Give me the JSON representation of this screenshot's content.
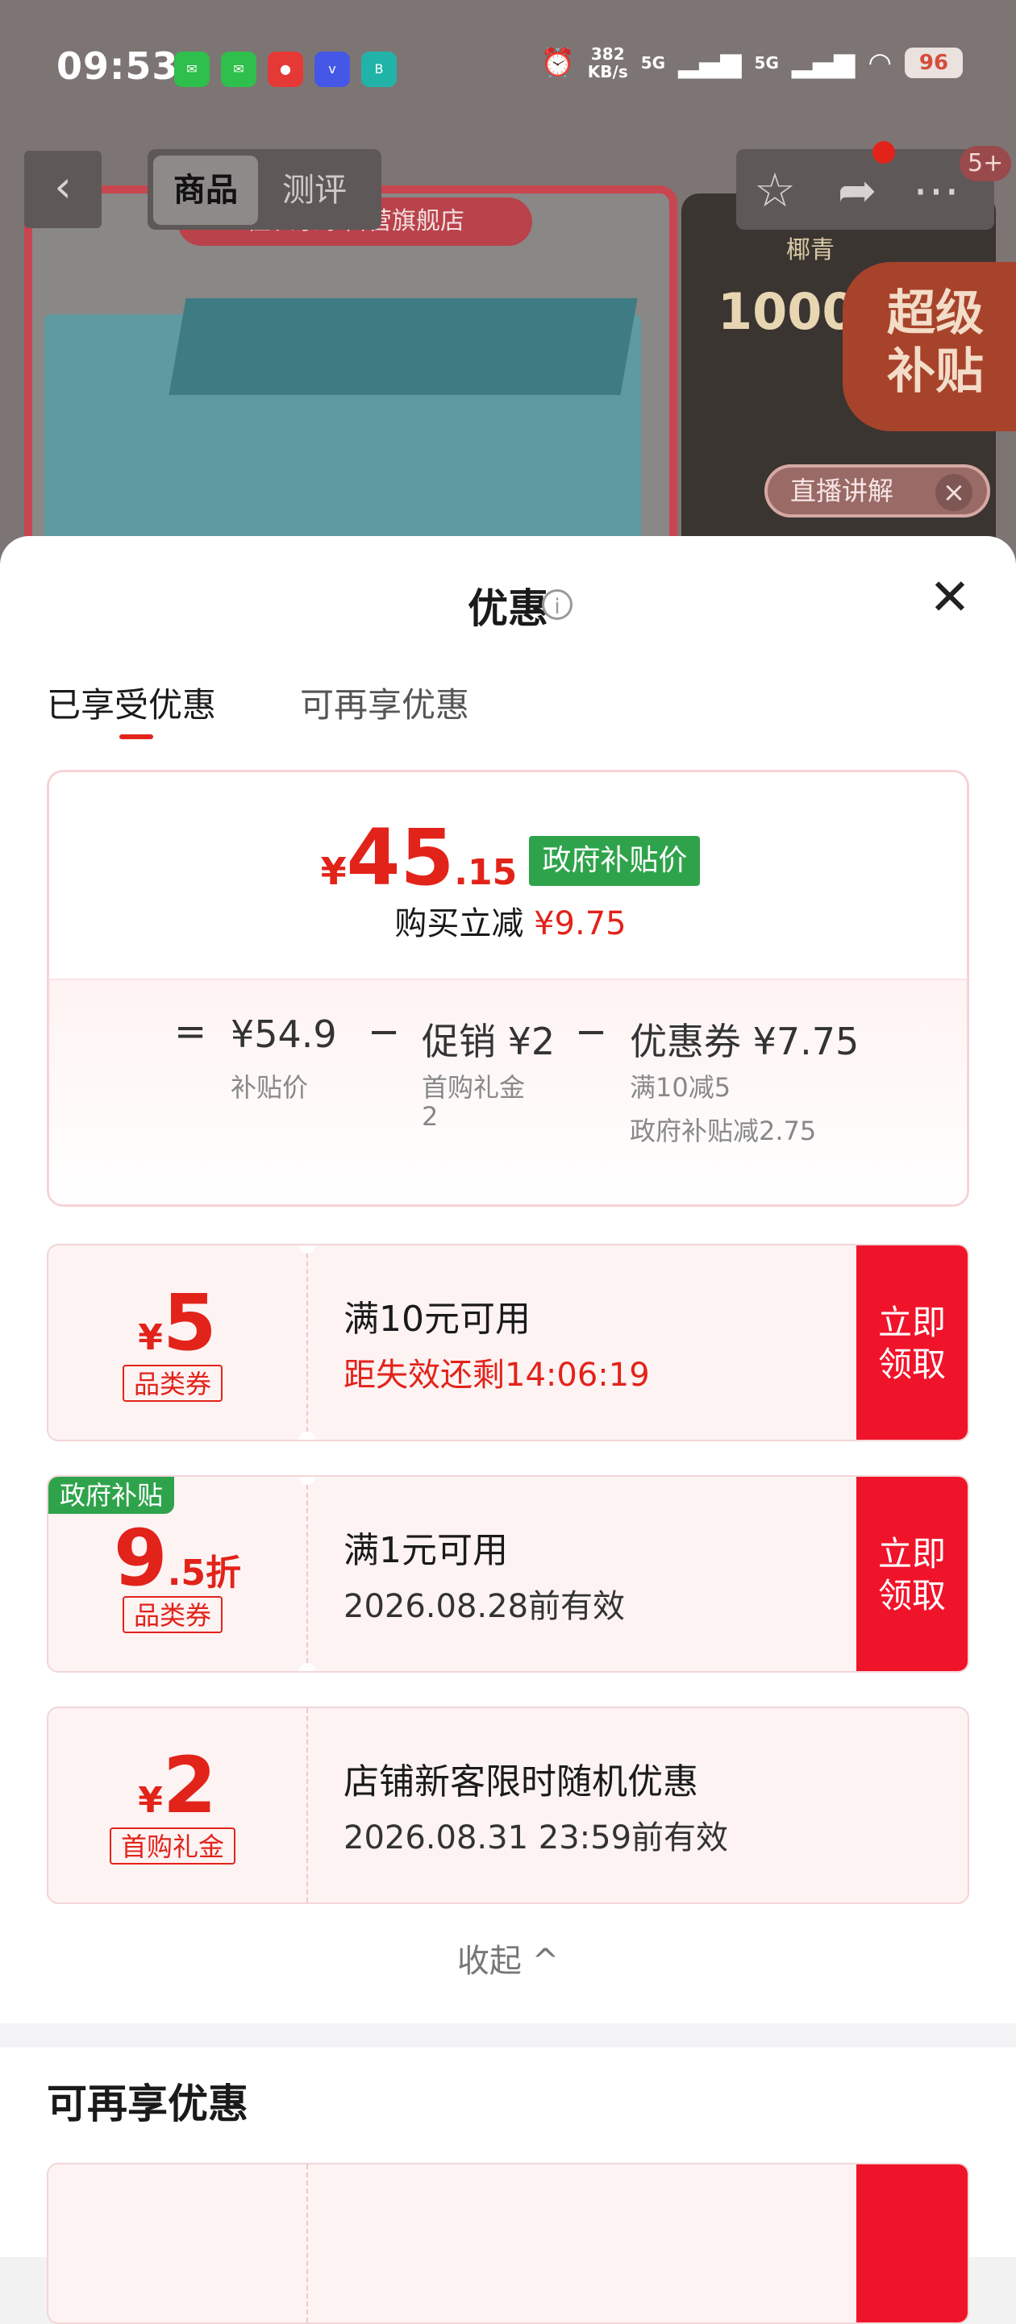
{
  "status_bar": {
    "time": "09:53",
    "speed_value": "382",
    "speed_unit": "KB/s",
    "net1": "5G",
    "net2": "5G",
    "battery": "96"
  },
  "nav": {
    "back_icon": "‹",
    "tab_product": "商品",
    "tab_review": "测评",
    "cart_count": "5+"
  },
  "background": {
    "store_name": "佳农京东自营旗舰店",
    "rank_label": "椰青",
    "rank_value": "1000",
    "subsidy_badge_line1": "超级",
    "subsidy_badge_line2": "补贴",
    "live_label": "直播讲解"
  },
  "sheet": {
    "title": "优惠",
    "tab_enjoyed": "已享受优惠",
    "tab_more": "可再享优惠",
    "summary": {
      "currency": "¥",
      "price_int": "45",
      "price_dec": ".15",
      "price_tag": "政府补贴价",
      "reduce_label": "购买立减",
      "reduce_amount": "¥9.75",
      "eq": "=",
      "base_price": "¥54.9",
      "base_label": "补贴价",
      "minus": "−",
      "promo": "促销 ¥2",
      "promo_label": "首购礼金",
      "promo_label2": "2",
      "coupon": "优惠券 ¥7.75",
      "coupon_detail1": "满10减5",
      "coupon_detail2": "政府补贴减2.75"
    },
    "coupons": [
      {
        "currency": "¥",
        "amount": "5",
        "decimal": "",
        "tag": "品类券",
        "condition": "满10元可用",
        "sub": "距失效还剩14:06:19",
        "claim": "立即领取",
        "corner": ""
      },
      {
        "currency": "",
        "amount": "9",
        "decimal": ".5折",
        "tag": "品类券",
        "condition": "满1元可用",
        "sub": "2026.08.28前有效",
        "claim": "立即领取",
        "corner": "政府补贴"
      },
      {
        "currency": "¥",
        "amount": "2",
        "decimal": "",
        "tag": "首购礼金",
        "condition": "店铺新客限时随机优惠",
        "sub": "2026.08.31 23:59前有效",
        "claim": "",
        "corner": ""
      }
    ],
    "collapse": "收起 ^",
    "more_title": "可再享优惠"
  }
}
